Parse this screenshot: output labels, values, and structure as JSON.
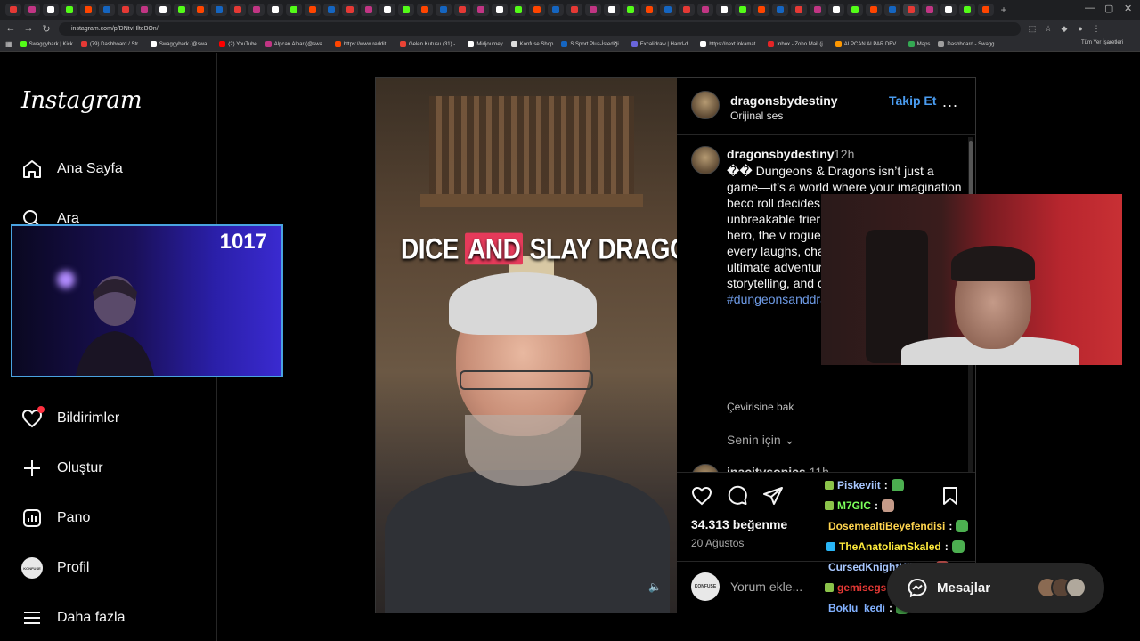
{
  "browser": {
    "url": "instagram.com/p/DNtvHlteBOn/",
    "tab_count": 53,
    "bookmarks": [
      {
        "label": "Swaggybark | Kick",
        "color": "#53fc18"
      },
      {
        "label": "(79) Dashboard / Str...",
        "color": "#e53935"
      },
      {
        "label": "Swaggybark (@swa...",
        "color": "#ffffff"
      },
      {
        "label": "(2) YouTube",
        "color": "#ff0000"
      },
      {
        "label": "Alpcan Alpar (@swa...",
        "color": "#c13584"
      },
      {
        "label": "https://www.reddit....",
        "color": "#ff4500"
      },
      {
        "label": "Gelen Kutusu (31) -...",
        "color": "#ea4335"
      },
      {
        "label": "Midjourney",
        "color": "#ffffff"
      },
      {
        "label": "Konfuse Shop",
        "color": "#dddddd"
      },
      {
        "label": "S Sport Plus-İstediği...",
        "color": "#1565c0"
      },
      {
        "label": "Excalidraw | Hand-d...",
        "color": "#6965db"
      },
      {
        "label": "https://next.inkamat...",
        "color": "#ffffff"
      },
      {
        "label": "Inbox - Zoho Mail (j...",
        "color": "#e42527"
      },
      {
        "label": "ALPCAN ALPAR DEV...",
        "color": "#ff9800"
      },
      {
        "label": "Maps",
        "color": "#34a853"
      },
      {
        "label": "Dashboard - Swagg...",
        "color": "#9e9e9e"
      }
    ],
    "all_bookmarks": "Tüm Yer İşaretleri"
  },
  "sidebar": {
    "logo": "Instagram",
    "items": [
      {
        "label": "Ana Sayfa",
        "icon": "home-icon"
      },
      {
        "label": "Ara",
        "icon": "search-icon"
      },
      {
        "label": "Bildirimler",
        "icon": "heart-icon"
      },
      {
        "label": "Oluştur",
        "icon": "plus-icon"
      },
      {
        "label": "Pano",
        "icon": "dashboard-icon"
      },
      {
        "label": "Profil",
        "icon": "profile-avatar"
      },
      {
        "label": "Daha fazla",
        "icon": "menu-icon"
      }
    ],
    "profile_avatar_text": "KONFUSE"
  },
  "stream_overlay": {
    "viewer_count": "1017"
  },
  "post": {
    "video_caption_text": {
      "before": "DICE ",
      "highlight": "AND",
      "after": " SLAY DRAGONS"
    },
    "username": "dragonsbydestiny",
    "audio": "Orijinal ses",
    "follow_label": "Takip Et",
    "more_label": "...",
    "caption_time": "12h",
    "caption_text": "�� Dungeons & Dragons isn’t just a game—it’s a world where your imagination beco roll decides fate, epic story, and ev unbreakable frier escape from real be the hero, the v rogue. No two ac same, and every laughs, chaos, an DnD is more thar ultimate adventure of creativity, storytelling, and connection. ��",
    "caption_tags": "#dungeonsanddragons #dandd",
    "translate_label": "Çevirisine bak",
    "for_you_label": "Senin için",
    "next_commenter": "inacitysonics",
    "next_comment_time": "11h",
    "likes": "34.313 beğenme",
    "date": "20 Ağustos",
    "comment_placeholder": "Yorum ekle...",
    "comment_avatar_text": "KONFUSE"
  },
  "chat": [
    {
      "user": "Piskeviit",
      "color": "#a9c8ff",
      "emote_color": "#4caf50"
    },
    {
      "user": "M7GIC",
      "color": "#7cff5b",
      "emote_color": "#c49a88"
    },
    {
      "user": "DosemealtiBeyefendisi",
      "color": "#ffd54f",
      "emote_color": "#4caf50"
    },
    {
      "user": "TheAnatolianSkaled",
      "color": "#ffeb3b",
      "emote_color": "#4caf50"
    },
    {
      "user": "CursedKnightKiller",
      "color": "#a9c8ff",
      "emote_color": "#c0504d"
    },
    {
      "user": "gemisegs",
      "color": "#e53935",
      "emote_color": "#4caf50"
    },
    {
      "user": "Boklu_kedi",
      "color": "#82b1ff",
      "emote_color": "#4caf50"
    }
  ],
  "messages": {
    "label": "Mesajlar"
  },
  "colors": {
    "accent_blue": "#4a9cf0",
    "notification_red": "#ff3040",
    "hashtag": "#6f9ce8"
  }
}
